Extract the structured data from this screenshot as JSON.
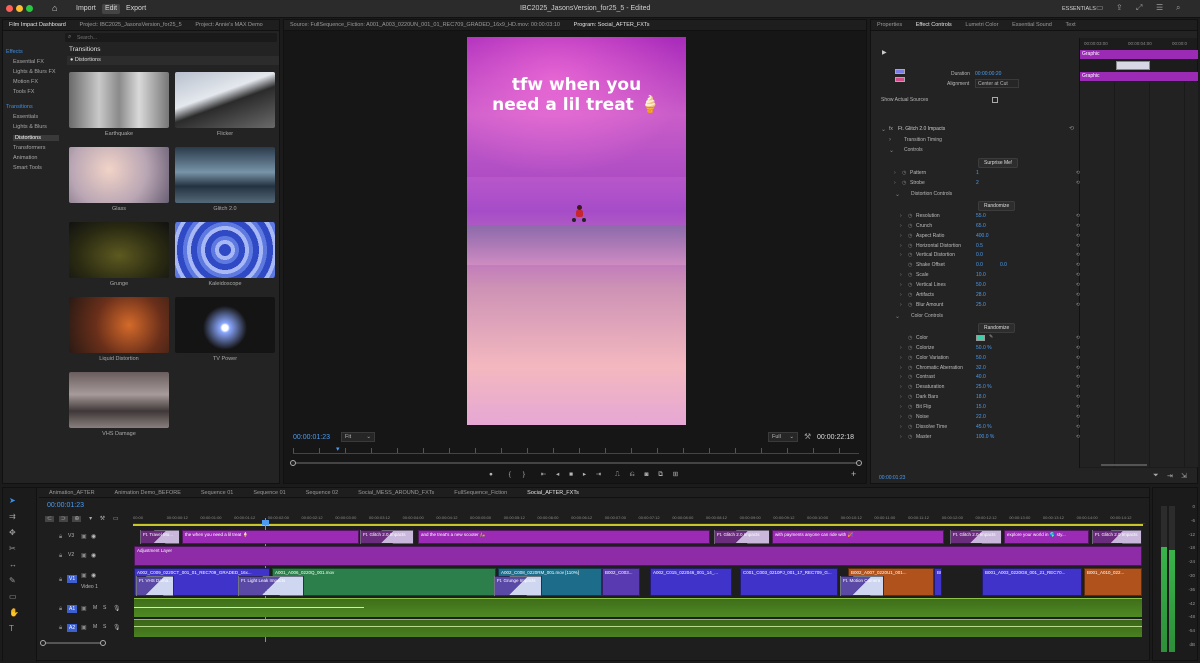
{
  "window": {
    "title": "IBC2025_JasonsVersion_for25_5 - Edited"
  },
  "menu": {
    "import": "Import",
    "edit": "Edit",
    "export": "Export",
    "workspace": "ESSENTIALS"
  },
  "left_panel": {
    "tabs": [
      "Film Impact Dashboard",
      "Project: IBC2025_JasonsVersion_for25_5",
      "Project: Annie's MAX Demo"
    ],
    "search_placeholder": "Search...",
    "categories": [
      {
        "label": "Effects",
        "kind": "head"
      },
      {
        "label": "Essential FX",
        "kind": "sub"
      },
      {
        "label": "Lights & Blurs FX",
        "kind": "sub"
      },
      {
        "label": "Motion FX",
        "kind": "sub"
      },
      {
        "label": "Tools FX",
        "kind": "sub"
      },
      {
        "label": "Transitions",
        "kind": "head"
      },
      {
        "label": "Essentials",
        "kind": "sub"
      },
      {
        "label": "Lights & Blurs",
        "kind": "sub"
      },
      {
        "label": "Distortions",
        "kind": "selected"
      },
      {
        "label": "Transformers",
        "kind": "sub"
      },
      {
        "label": "Animation",
        "kind": "sub"
      },
      {
        "label": "Smart Tools",
        "kind": "sub"
      }
    ],
    "grid_title": "Transitions",
    "grid_subtitle": "● Distortions",
    "transitions": [
      "Earthquake",
      "Flicker",
      "Glass",
      "Glitch 2.0",
      "Grunge",
      "Kaleidoscope",
      "Liquid Distortion",
      "TV Power",
      "VHS Damage"
    ]
  },
  "source_tab": "Source: FullSequence_Fiction: A001_A003_0220UN_001_01_REC709_GRADED_16x9_HD.mov: 00:00:03:10",
  "program": {
    "tab": "Program: Social_AFTER_FXTs",
    "overlay_line1": "tfw when you",
    "overlay_line2": "need a lil treat 🍦",
    "timecode": "00:00:01:23",
    "fit": "Fit",
    "full": "Full",
    "duration": "00:00:22:18"
  },
  "right_tabs": [
    "Properties",
    "Effect Controls",
    "Lumetri Color",
    "Essential Sound",
    "Text"
  ],
  "effect_controls": {
    "duration_label": "Duration",
    "duration_value": "00:00:00:20",
    "alignment_label": "Alignment",
    "alignment_value": "Center at Cut",
    "show_sources": "Show Actual Sources",
    "ruler": [
      "00:00:03:00",
      "00:00:04:00",
      "00:00:0"
    ],
    "graphic_label_a": "Graphic",
    "graphic_label_b": "Graphic",
    "effect_name": "Ft. Glitch 2.0 Impacts",
    "transition_timing": "Transition Timing",
    "controls": "Controls",
    "surprise": "Surprise Me!",
    "distortion_controls": "Distortion Controls",
    "randomize": "Randomize",
    "color_controls": "Color Controls",
    "randomize2": "Randomize",
    "bottom_timecode": "00:00:01:23",
    "params": [
      {
        "name": "Pattern",
        "value": "1",
        "value2": ""
      },
      {
        "name": "Strobe",
        "value": "2",
        "value2": ""
      },
      {
        "name": "Resolution",
        "value": "55.0",
        "value2": ""
      },
      {
        "name": "Crunch",
        "value": "65.0",
        "value2": ""
      },
      {
        "name": "Aspect Ratio",
        "value": "400.0",
        "value2": ""
      },
      {
        "name": "Horizontal Distortion",
        "value": "0.5",
        "value2": ""
      },
      {
        "name": "Vertical Distortion",
        "value": "0.0",
        "value2": ""
      },
      {
        "name": "Shake Offset",
        "value": "0.0",
        "value2": "0.0"
      },
      {
        "name": "Scale",
        "value": "10.0",
        "value2": ""
      },
      {
        "name": "Vertical Lines",
        "value": "50.0",
        "value2": ""
      },
      {
        "name": "Artifacts",
        "value": "28.0",
        "value2": ""
      },
      {
        "name": "Blur Amount",
        "value": "25.0",
        "value2": ""
      },
      {
        "name": "Color",
        "value": "",
        "value2": ""
      },
      {
        "name": "Colorize",
        "value": "50.0 %",
        "value2": ""
      },
      {
        "name": "Color Variation",
        "value": "50.0",
        "value2": ""
      },
      {
        "name": "Chromatic Aberration",
        "value": "32.0",
        "value2": ""
      },
      {
        "name": "Contrast",
        "value": "40.0",
        "value2": ""
      },
      {
        "name": "Desaturation",
        "value": "25.0 %",
        "value2": ""
      },
      {
        "name": "Dark Bars",
        "value": "18.0",
        "value2": ""
      },
      {
        "name": "Bit Flip",
        "value": "15.0",
        "value2": ""
      },
      {
        "name": "Noise",
        "value": "22.0",
        "value2": ""
      },
      {
        "name": "Dissolve Time",
        "value": "45.0 %",
        "value2": ""
      },
      {
        "name": "Master",
        "value": "100.0 %",
        "value2": ""
      }
    ]
  },
  "timeline": {
    "tabs": [
      "Animation_AFTER",
      "Animation Demo_BEFORE",
      "Sequence 01",
      "Sequence 01",
      "Sequence 02",
      "Social_MESS_AROUND_FXTs",
      "FullSequence_Fiction",
      "Social_AFTER_FXTs"
    ],
    "timecode": "00:00:01:23",
    "ruler": [
      "00:00",
      "00:00:00:12",
      "00:00:01:00",
      "00:00:01:12",
      "00:00:02:00",
      "00:00:02:12",
      "00:00:03:00",
      "00:00:03:12",
      "00:00:04:00",
      "00:00:04:12",
      "00:00:05:00",
      "00:00:05:12",
      "00:00:06:00",
      "00:00:06:12",
      "00:00:07:00",
      "00:00:07:12",
      "00:00:08:00",
      "00:00:08:12",
      "00:00:09:00",
      "00:00:09:12",
      "00:00:10:00",
      "00:00:10:12",
      "00:00:11:00",
      "00:00:11:12",
      "00:00:12:00",
      "00:00:12:12",
      "00:00:13:00",
      "00:00:13:12",
      "00:00:14:00",
      "00:00:14:12"
    ],
    "tracks": [
      "V3",
      "V2",
      "V1",
      "A1",
      "A2"
    ],
    "track_label": "Video 1",
    "v3_clips": [
      "Ft. Travel Mo...",
      "the when you need a lil treat 🍦",
      "Ft. Glitch 2.0 Impacts",
      "and the treat's a new scooter 🛵",
      "Ft. Glitch 2.0 Impacts",
      "with payments anyone can ride with 🎉",
      "Ft. Glitch 2.0 Impacts",
      "explore your world in 🌎 sty...",
      "Ft. Glitch 2.0 Impacts"
    ],
    "v2_clip": "Adjustment Layer",
    "v1_clips": [
      "A002_C009_0220CT_001_01_REC709_GRADED_16x...",
      "A001_A006_0220Q_001.mov",
      "A002_C008_0220RM_001.mov [110%]",
      "B002_C003...",
      "A002_C015_022046_001_14_...",
      "C001_C003_0210PJ_001_17_REC709_G...",
      "B002_A007_0220U1_001...",
      "B001_A00...",
      "B001_A003_0220G8_001_21_REC70...",
      "B001_A010_022..."
    ],
    "v1_fx": [
      "Ft. VHS Dama...",
      "Ft. Light Leak Impacts",
      "Ft. Grunge Impacts",
      "Ft. Motion Camera"
    ]
  },
  "audio_meter": [
    "0",
    "-6",
    "-12",
    "-18",
    "-24",
    "-30",
    "-36",
    "-42",
    "-48",
    "-54",
    "dB"
  ],
  "colors": {
    "accent": "#3d8ee6",
    "graphic_clip": "#9b2bb4",
    "video_clip": "#3f33c9",
    "audio_clip": "#4e8a1f"
  }
}
